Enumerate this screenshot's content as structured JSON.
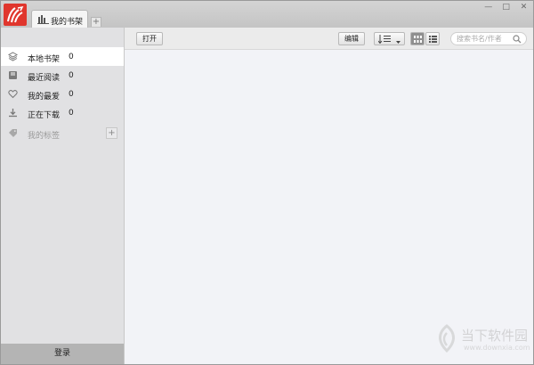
{
  "tabs": [
    {
      "label": "我的书架"
    }
  ],
  "new_tab_label": "+",
  "window_controls": {
    "minimize": "—",
    "maximize": "□",
    "close": "✕"
  },
  "toolbar": {
    "open_label": "打开",
    "edit_label": "编辑",
    "search_placeholder": "搜索书名/作者"
  },
  "sidebar": {
    "items": [
      {
        "label": "本地书架",
        "count": "0",
        "icon": "layers-icon"
      },
      {
        "label": "最近阅读",
        "count": "0",
        "icon": "book-icon"
      },
      {
        "label": "我的最爱",
        "count": "0",
        "icon": "heart-icon"
      },
      {
        "label": "正在下载",
        "count": "0",
        "icon": "download-icon"
      },
      {
        "label": "我的标签",
        "icon": "tag-icon"
      }
    ],
    "add_tag_label": "+",
    "login_label": "登录"
  },
  "watermark": {
    "text": "当下软件园",
    "url": "www.downxia.com"
  },
  "colors": {
    "brand_red": "#e0362d",
    "active_bg": "#ffffff",
    "sidebar_bg": "#e1e1e3",
    "content_bg": "#f2f3f7"
  }
}
